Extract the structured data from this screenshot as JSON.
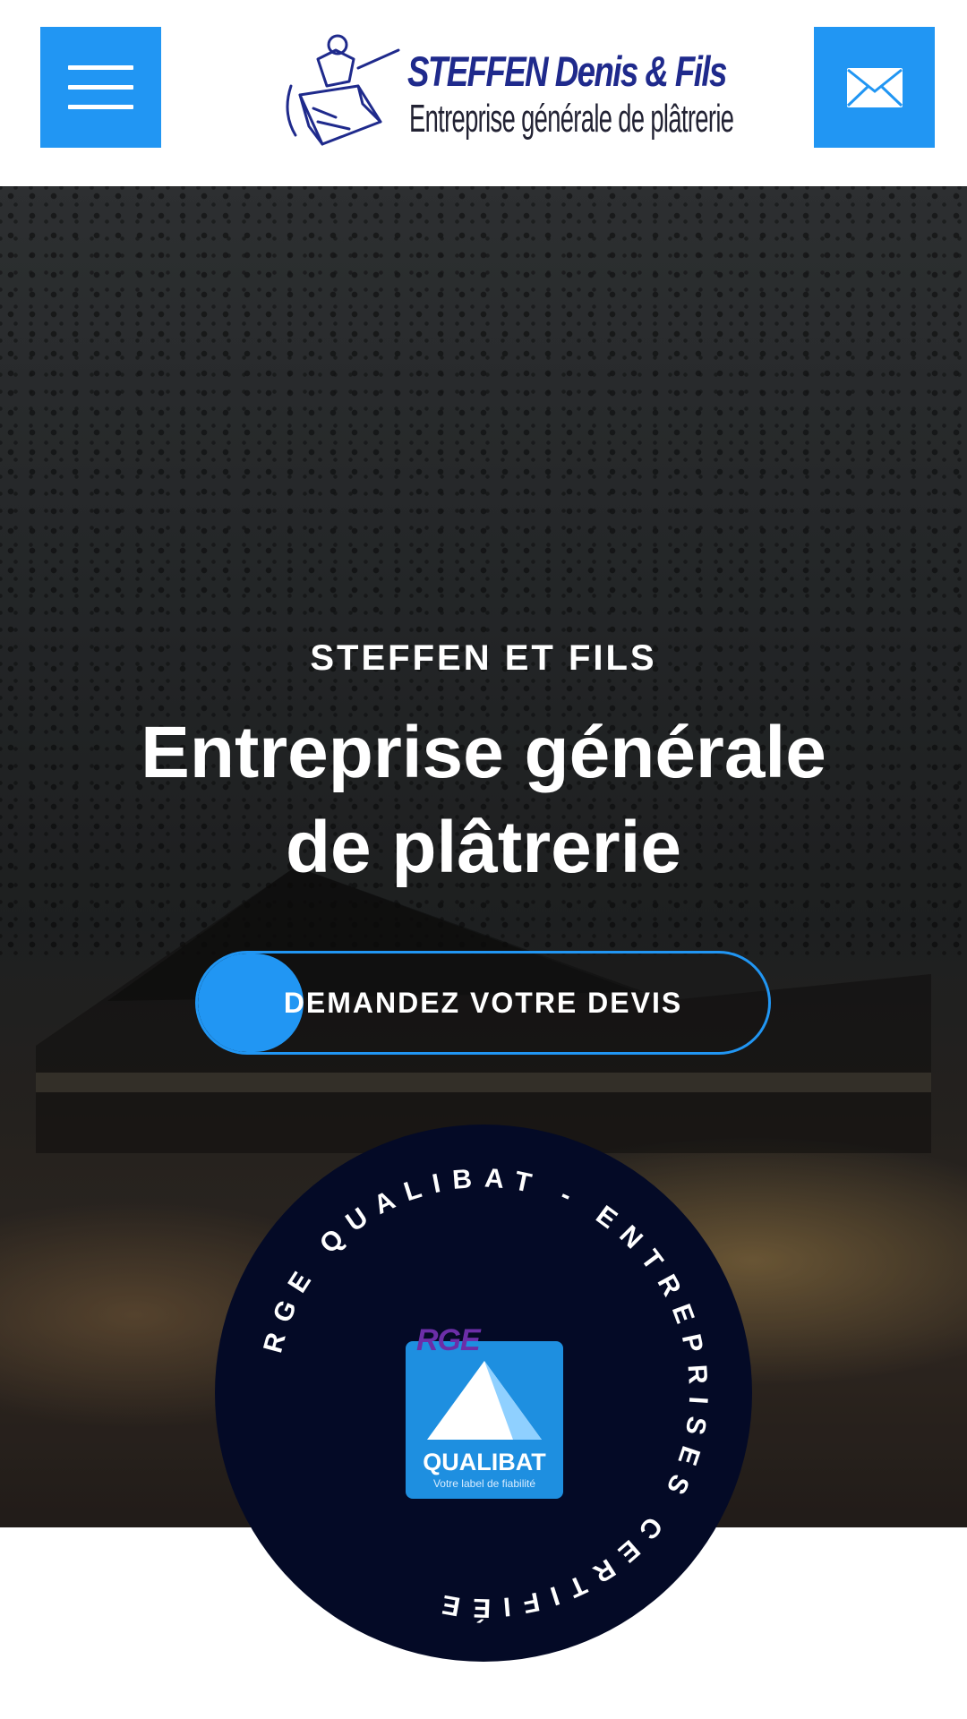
{
  "header": {
    "menu_icon": "hamburger-icon",
    "mail_icon": "envelope-icon",
    "logo": {
      "title": "STEFFEN Denis & Fils",
      "subtitle": "Entreprise générale de plâtrerie"
    }
  },
  "hero": {
    "eyebrow": "STEFFEN ET FILS",
    "headline_line1": "Entreprise générale",
    "headline_line2": "de plâtrerie",
    "cta_label": "DEMANDEZ VOTRE DEVIS"
  },
  "badge": {
    "ring_text": "RGE QUALIBAT - ENTREPRISES CERTIFIÉE",
    "logo_tag": "RGE",
    "logo_name": "QUALIBAT",
    "logo_slogan": "Votre label de fiabilité"
  },
  "colors": {
    "accent": "#2196f3",
    "badge_bg": "#040a26",
    "logo_navy": "#1f2a8c",
    "rge_purple": "#6c2ea8"
  }
}
